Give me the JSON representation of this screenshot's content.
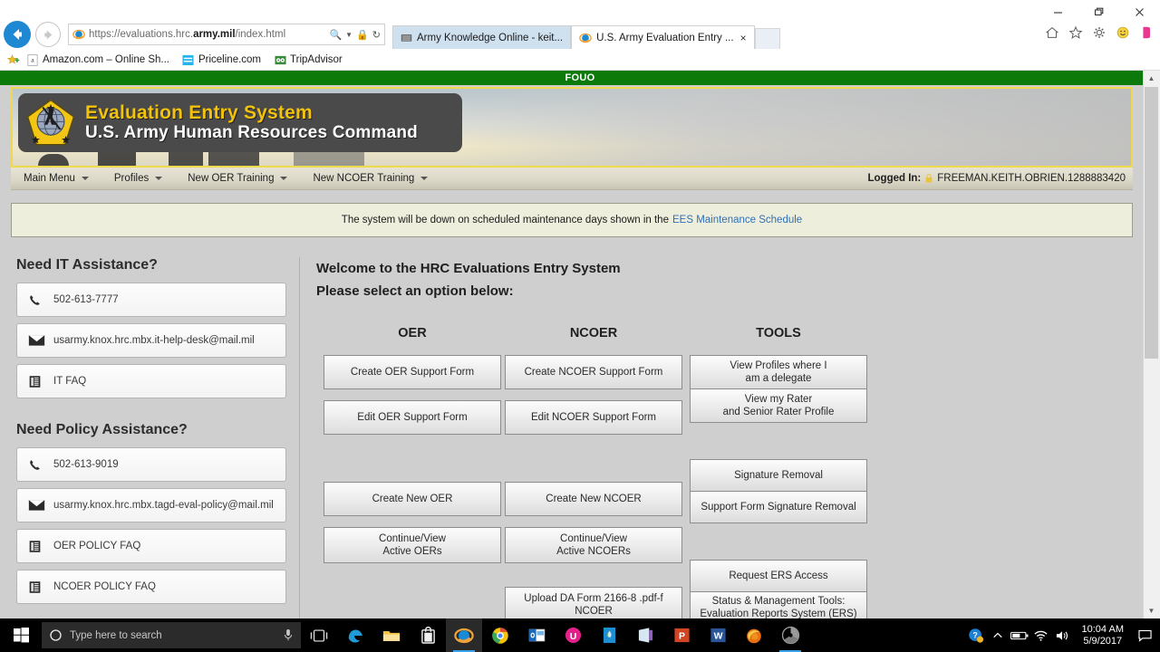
{
  "browser": {
    "url_prefix": "https://evaluations.hrc.",
    "url_bold": "army.mil",
    "url_suffix": "/index.html",
    "window_controls": {
      "minimize": "minimize-icon",
      "restore": "restore-icon",
      "close": "close-icon"
    },
    "tabs": [
      {
        "title": "Army Knowledge Online - keit...",
        "icon": "ako-icon",
        "active": false
      },
      {
        "title": "U.S. Army Evaluation Entry ...",
        "icon": "ie-icon",
        "active": true,
        "close": "×"
      }
    ],
    "chrome_icons": [
      "home-icon",
      "favorites-star-icon",
      "gear-icon",
      "smiley-icon"
    ],
    "favorites": [
      {
        "label": "Amazon.com – Online Sh...",
        "icon": "amazon-icon"
      },
      {
        "label": "Priceline.com",
        "icon": "priceline-icon"
      },
      {
        "label": "TripAdvisor",
        "icon": "tripadvisor-icon"
      }
    ]
  },
  "page": {
    "classification_banner": "FOUO",
    "banner": {
      "title": "Evaluation Entry System",
      "subtitle": "U.S. Army Human Resources Command",
      "crest": "hrc-crest-icon"
    },
    "menubar": {
      "items": [
        {
          "label": "Main Menu",
          "has_caret": true
        },
        {
          "label": "Profiles",
          "has_caret": true
        },
        {
          "label": "New OER Training",
          "has_caret": true
        },
        {
          "label": "New NCOER Training",
          "has_caret": true
        }
      ],
      "logged_in_label": "Logged In:",
      "logged_in_user": "FREEMAN.KEITH.OBRIEN.1288883420"
    },
    "notice": {
      "text": "The system will be down on scheduled maintenance days shown in the",
      "link": "EES Maintenance Schedule"
    },
    "sidebar": {
      "it_heading": "Need IT Assistance?",
      "it_items": [
        {
          "label": "502-613-7777",
          "icon": "phone-icon"
        },
        {
          "label": "usarmy.knox.hrc.mbx.it-help-desk@mail.mil",
          "icon": "envelope-icon"
        },
        {
          "label": "IT FAQ",
          "icon": "document-icon"
        }
      ],
      "policy_heading": "Need Policy Assistance?",
      "policy_items": [
        {
          "label": "502-613-9019",
          "icon": "phone-icon"
        },
        {
          "label": "usarmy.knox.hrc.mbx.tagd-eval-policy@mail.mil",
          "icon": "envelope-icon"
        },
        {
          "label": "OER POLICY FAQ",
          "icon": "document-icon"
        },
        {
          "label": "NCOER POLICY FAQ",
          "icon": "document-icon"
        }
      ]
    },
    "main": {
      "welcome_line1": "Welcome to the HRC Evaluations Entry System",
      "welcome_line2": "Please select an option below:",
      "columns": [
        {
          "heading": "OER",
          "buttons": [
            "Create OER Support Form",
            "Edit OER Support Form",
            "Create New OER",
            "Continue/View\nActive OERs"
          ]
        },
        {
          "heading": "NCOER",
          "buttons": [
            "Create NCOER Support Form",
            "Edit NCOER Support Form",
            "Create New NCOER",
            "Continue/View\nActive NCOERs",
            "Upload DA Form 2166-8 .pdf-f\nNCOER"
          ]
        },
        {
          "heading": "TOOLS",
          "buttons": [
            "View Profiles where I\nam a delegate",
            "View my Rater\nand Senior Rater Profile",
            "Signature Removal",
            "Support Form Signature Removal",
            "Request ERS Access",
            "Status & Management Tools:\nEvaluation Reports System (ERS)"
          ]
        }
      ]
    },
    "labels": {
      "oer_b1": "Create OER Support Form",
      "oer_b2": "Edit OER Support Form",
      "oer_b3": "Create New OER",
      "oer_b4a": "Continue/View",
      "oer_b4b": "Active OERs",
      "ncoer_b1": "Create NCOER Support Form",
      "ncoer_b2": "Edit NCOER Support Form",
      "ncoer_b3": "Create New NCOER",
      "ncoer_b4a": "Continue/View",
      "ncoer_b4b": "Active NCOERs",
      "ncoer_b5a": "Upload DA Form 2166-8 .pdf-f",
      "ncoer_b5b": "NCOER",
      "tools_b1a": "View Profiles where I",
      "tools_b1b": "am a delegate",
      "tools_b2a": "View my Rater",
      "tools_b2b": "and Senior Rater Profile",
      "tools_b3": "Signature Removal",
      "tools_b4": "Support Form Signature Removal",
      "tools_b5": "Request ERS Access",
      "tools_b6a": "Status & Management Tools:",
      "tools_b6b": "Evaluation Reports System (ERS)"
    },
    "colors": {
      "fouo_green": "#0b7a0b",
      "banner_gold": "#f2c20c",
      "link_blue": "#2f6fb5",
      "page_gray": "#cfcfcf"
    }
  },
  "taskbar": {
    "start": "windows-start-icon",
    "search_placeholder": "Type here to search",
    "mic": "microphone-icon",
    "pinned": [
      "task-view-icon",
      "edge-icon",
      "file-explorer-icon",
      "store-icon",
      "internet-explorer-icon",
      "chrome-icon",
      "outlook-icon",
      "skype-icon",
      "notes-icon",
      "onenote-icon",
      "powerpoint-icon",
      "word-icon",
      "firefox-icon",
      "media-icon"
    ],
    "tray": [
      "help-icon",
      "chevron-up-icon",
      "battery-icon",
      "wifi-icon",
      "volume-icon"
    ],
    "time": "10:04 AM",
    "date": "5/9/2017",
    "action_center": "action-center-icon"
  }
}
